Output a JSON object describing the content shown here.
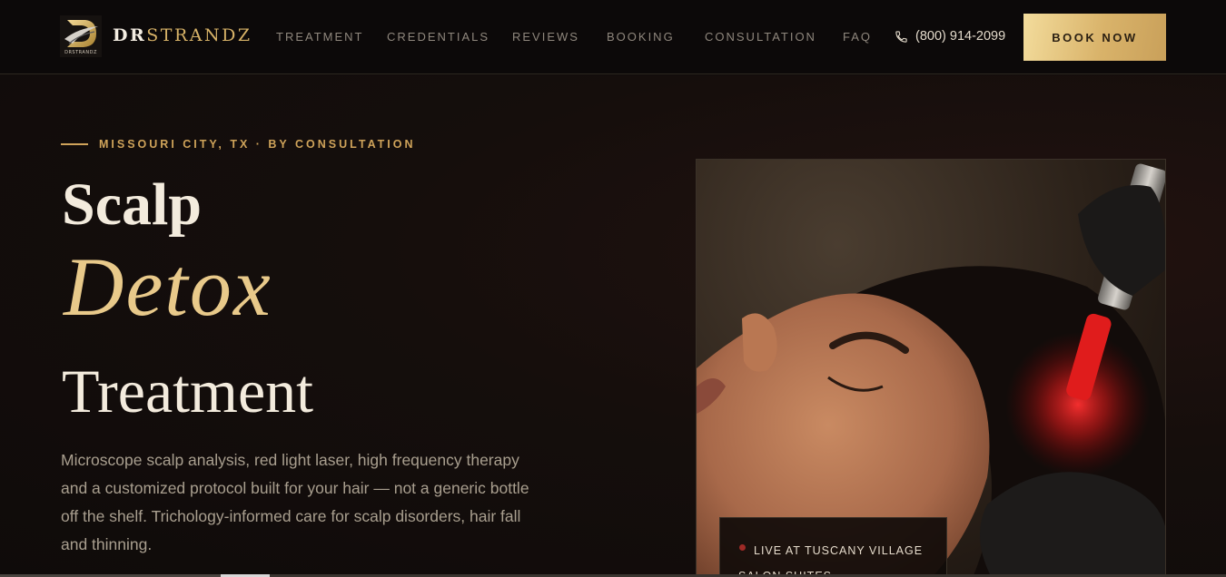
{
  "brand": {
    "logo_letter": "D",
    "logo_subtext": "DRSTRANDZ",
    "name_part1": "DR",
    "name_part2": "STRANDZ",
    "accent_color": "#d8b368"
  },
  "nav": {
    "items": [
      {
        "label": "TREATMENT"
      },
      {
        "label": "CREDENTIALS"
      },
      {
        "label": "REVIEWS"
      },
      {
        "label": "BOOKING"
      },
      {
        "label": "CONSULTATION"
      },
      {
        "label": "FAQ"
      }
    ],
    "phone": "(800) 914-2099",
    "phone_icon": "phone-icon",
    "book_label": "BOOK NOW"
  },
  "hero": {
    "eyebrow": "MISSOURI CITY, TX · BY CONSULTATION",
    "title_line1": "Scalp",
    "title_line2": "Detox",
    "title_line3": "Treatment",
    "description": "Microscope scalp analysis, red light laser, high frequency therapy and a customized protocol built for your hair — not a generic bottle off the shelf. Trichology-informed care for scalp disorders, hair fall and thinning."
  },
  "photo_card": {
    "live_label": "LIVE AT TUSCANY VILLAGE SALON SUITES"
  }
}
